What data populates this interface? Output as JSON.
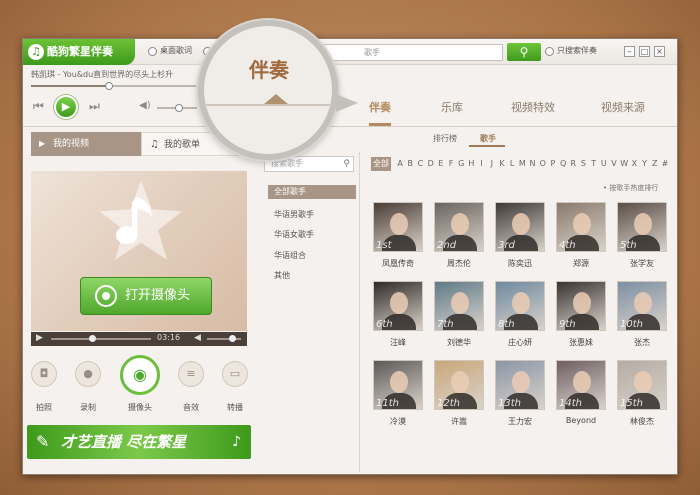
{
  "app": {
    "title": "酷狗繁星伴奏",
    "logo_glyph": "♫"
  },
  "titlebar": {
    "desktop_lyrics_label": "桌面歌词",
    "search_placeholder": "歌手",
    "search_button_glyph": "⚲",
    "only_search_label": "只搜索伴奏",
    "min_glyph": "–",
    "max_glyph": "□",
    "close_glyph": "×"
  },
  "player": {
    "marquee": "韩凯琪 - You&du直到世界的尽头上杉升",
    "progress": 0.36,
    "volume": 0.55,
    "prev_glyph": "⏮",
    "play_glyph": "▶",
    "next_glyph": "⏭",
    "volume_glyph": "◀)"
  },
  "main_tabs": [
    {
      "label": "伴奏",
      "active": true
    },
    {
      "label": "乐库",
      "active": false
    },
    {
      "label": "视频特效",
      "active": false
    },
    {
      "label": "视频来源",
      "active": false
    }
  ],
  "left_tabs": [
    {
      "label": "我的视频",
      "icon": "video-icon",
      "glyph": "▶"
    },
    {
      "label": "我的歌单",
      "icon": "music-icon",
      "glyph": "♫"
    }
  ],
  "video": {
    "camera_button_label": "打开摄像头",
    "time": "03:16",
    "play_glyph": "▶",
    "volume_glyph": "◀"
  },
  "tools": [
    {
      "label": "拍照",
      "icon": "camera-icon",
      "glyph": "◘"
    },
    {
      "label": "录制",
      "icon": "record-icon",
      "glyph": "●"
    },
    {
      "label": "摄像头",
      "icon": "webcam-icon",
      "glyph": "◉"
    },
    {
      "label": "音效",
      "icon": "sound-icon",
      "glyph": "≡"
    },
    {
      "label": "转播",
      "icon": "broadcast-icon",
      "glyph": "▭"
    }
  ],
  "banner": {
    "text": "才艺直播 尽在繁星"
  },
  "magnifier": {
    "text": "伴奏"
  },
  "sub_tabs": [
    {
      "label": "排行榜",
      "active": false
    },
    {
      "label": "歌手",
      "active": true
    }
  ],
  "category": {
    "search_placeholder": "搜索歌手",
    "search_glyph": "⚲",
    "items": [
      {
        "label": "全部歌手",
        "active": true
      },
      {
        "label": "华语男歌手",
        "active": false
      },
      {
        "label": "华语女歌手",
        "active": false
      },
      {
        "label": "华语组合",
        "active": false
      },
      {
        "label": "其他",
        "active": false
      }
    ]
  },
  "alphabet": [
    "全部",
    "A",
    "B",
    "C",
    "D",
    "E",
    "F",
    "G",
    "H",
    "I",
    "J",
    "K",
    "L",
    "M",
    "N",
    "O",
    "P",
    "Q",
    "R",
    "S",
    "T",
    "U",
    "V",
    "W",
    "X",
    "Y",
    "Z",
    "#"
  ],
  "rank_link": "• 按歌手热度排行",
  "artists": [
    {
      "name": "凤凰传奇",
      "rank": "1st",
      "color": "#4a3d35"
    },
    {
      "name": "周杰伦",
      "rank": "2nd",
      "color": "#6b6560"
    },
    {
      "name": "陈奕迅",
      "rank": "3rd",
      "color": "#3f3a37"
    },
    {
      "name": "郑源",
      "rank": "4th",
      "color": "#8a7a6c"
    },
    {
      "name": "张学友",
      "rank": "5th",
      "color": "#5a4f48"
    },
    {
      "name": "汪峰",
      "rank": "6th",
      "color": "#2f2b29"
    },
    {
      "name": "刘德华",
      "rank": "7th",
      "color": "#5f7a8a"
    },
    {
      "name": "庄心妍",
      "rank": "8th",
      "color": "#6e8aa0"
    },
    {
      "name": "张惠妹",
      "rank": "9th",
      "color": "#3a3432"
    },
    {
      "name": "张杰",
      "rank": "10th",
      "color": "#7d8fa3"
    },
    {
      "name": "冷漠",
      "rank": "11th",
      "color": "#5c5a58"
    },
    {
      "name": "许嵩",
      "rank": "12th",
      "color": "#c9a87a"
    },
    {
      "name": "王力宏",
      "rank": "13th",
      "color": "#8a96a6"
    },
    {
      "name": "Beyond",
      "rank": "14th",
      "color": "#6d5f62"
    },
    {
      "name": "林俊杰",
      "rank": "15th",
      "color": "#b3aba4"
    }
  ]
}
